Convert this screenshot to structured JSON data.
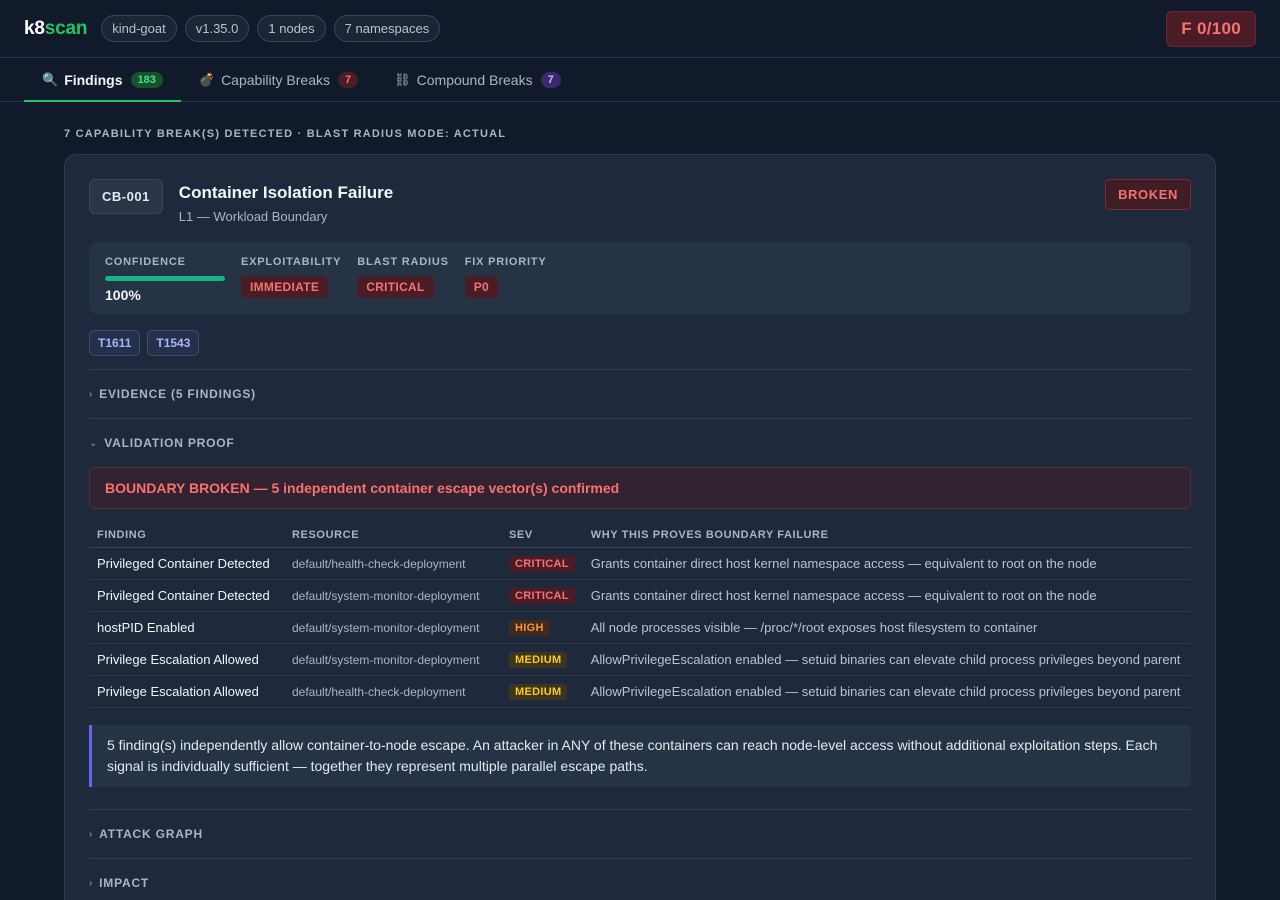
{
  "header": {
    "logo_k8": "k8",
    "logo_scan": "scan",
    "pills": [
      "kind-goat",
      "v1.35.0",
      "1 nodes",
      "7 namespaces"
    ],
    "score": "F  0/100"
  },
  "tabs": [
    {
      "icon": "🔍",
      "label": "Findings",
      "count": "183"
    },
    {
      "icon": "💣",
      "label": "Capability Breaks",
      "count": "7"
    },
    {
      "icon": "⛓",
      "label": "Compound Breaks",
      "count": "7"
    }
  ],
  "main": {
    "section_title": "7 CAPABILITY BREAK(S) DETECTED · BLAST RADIUS MODE: ACTUAL"
  },
  "card": {
    "id": "CB-001",
    "title": "Container Isolation Failure",
    "subtitle": "L1 — Workload Boundary",
    "status": "BROKEN",
    "metrics": {
      "confidence_label": "CONFIDENCE",
      "confidence_value": "100%",
      "confidence_fraction": 1.0,
      "exploitability_label": "EXPLOITABILITY",
      "exploitability_value": "IMMEDIATE",
      "blast_label": "BLAST RADIUS",
      "blast_value": "CRITICAL",
      "priority_label": "FIX PRIORITY",
      "priority_value": "P0"
    },
    "techniques": [
      "T1611",
      "T1543"
    ],
    "sections": {
      "evidence": "EVIDENCE (5 FINDINGS)",
      "validation": "VALIDATION PROOF",
      "attack_graph": "ATTACK GRAPH",
      "impact": "IMPACT"
    },
    "proof_banner": "BOUNDARY BROKEN — 5 independent container escape vector(s) confirmed",
    "table": {
      "headers": [
        "FINDING",
        "RESOURCE",
        "SEV",
        "WHY THIS PROVES BOUNDARY FAILURE"
      ],
      "rows": [
        {
          "finding": "Privileged Container Detected",
          "resource": "default/health-check-deployment",
          "sev": "CRITICAL",
          "sev_class": "critical",
          "why": "Grants container direct host kernel namespace access — equivalent to root on the node"
        },
        {
          "finding": "Privileged Container Detected",
          "resource": "default/system-monitor-deployment",
          "sev": "CRITICAL",
          "sev_class": "critical",
          "why": "Grants container direct host kernel namespace access — equivalent to root on the node"
        },
        {
          "finding": "hostPID Enabled",
          "resource": "default/system-monitor-deployment",
          "sev": "HIGH",
          "sev_class": "high",
          "why": "All node processes visible — /proc/*/root exposes host filesystem to container"
        },
        {
          "finding": "Privilege Escalation Allowed",
          "resource": "default/system-monitor-deployment",
          "sev": "MEDIUM",
          "sev_class": "medium",
          "why": "AllowPrivilegeEscalation enabled — setuid binaries can elevate child process privileges beyond parent"
        },
        {
          "finding": "Privilege Escalation Allowed",
          "resource": "default/health-check-deployment",
          "sev": "MEDIUM",
          "sev_class": "medium",
          "why": "AllowPrivilegeEscalation enabled — setuid binaries can elevate child process privileges beyond parent"
        }
      ]
    },
    "explanation": "5 finding(s) independently allow container-to-node escape. An attacker in ANY of these containers can reach node-level access without additional exploitation steps. Each signal is individually sufficient — together they represent multiple parallel escape paths."
  },
  "colors": {
    "accent_green": "#22c55e",
    "critical": "#f87171",
    "high": "#fb923c",
    "medium": "#facc15",
    "indigo": "#6366f1"
  }
}
